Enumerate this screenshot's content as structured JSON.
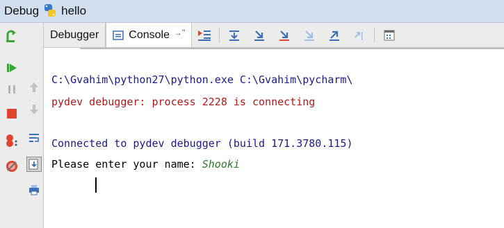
{
  "title_bar": {
    "label_debug": "Debug",
    "label_config": "hello"
  },
  "tabs": [
    {
      "label": "Debugger"
    },
    {
      "label": "Console"
    }
  ],
  "toolbar": {
    "icons": [
      "show-execution-point-icon",
      "step-over-icon",
      "step-into-icon",
      "step-into-my-code-icon",
      "force-step-into-icon",
      "step-out-icon",
      "run-to-cursor-icon",
      "evaluate-expression-icon"
    ]
  },
  "left_toolbar": {
    "icons": [
      "rerun-icon",
      "resume-icon",
      "pause-icon",
      "stop-icon",
      "view-breakpoints-icon",
      "mute-breakpoints-icon"
    ]
  },
  "side_toolbar": {
    "icons": [
      "up-arrow-icon",
      "down-arrow-icon",
      "soft-wrap-icon",
      "scroll-to-end-icon",
      "print-icon"
    ]
  },
  "console": {
    "lines": [
      {
        "text": "C:\\Gvahim\\python27\\python.exe C:\\Gvahim\\pycharm\\",
        "kind": "out"
      },
      {
        "text": "pydev debugger: process 2228 is connecting",
        "kind": "err"
      },
      {
        "text": "",
        "kind": "out"
      },
      {
        "text": "Connected to pydev debugger (build 171.3780.115)",
        "kind": "out"
      }
    ],
    "prompt": "Please enter your name: ",
    "user_input": "Shooki"
  },
  "colors": {
    "stdout": "#1a1a8c",
    "stderr": "#b2191a",
    "user_input": "#2a7a2a",
    "title_bar": "#d2dff0"
  }
}
